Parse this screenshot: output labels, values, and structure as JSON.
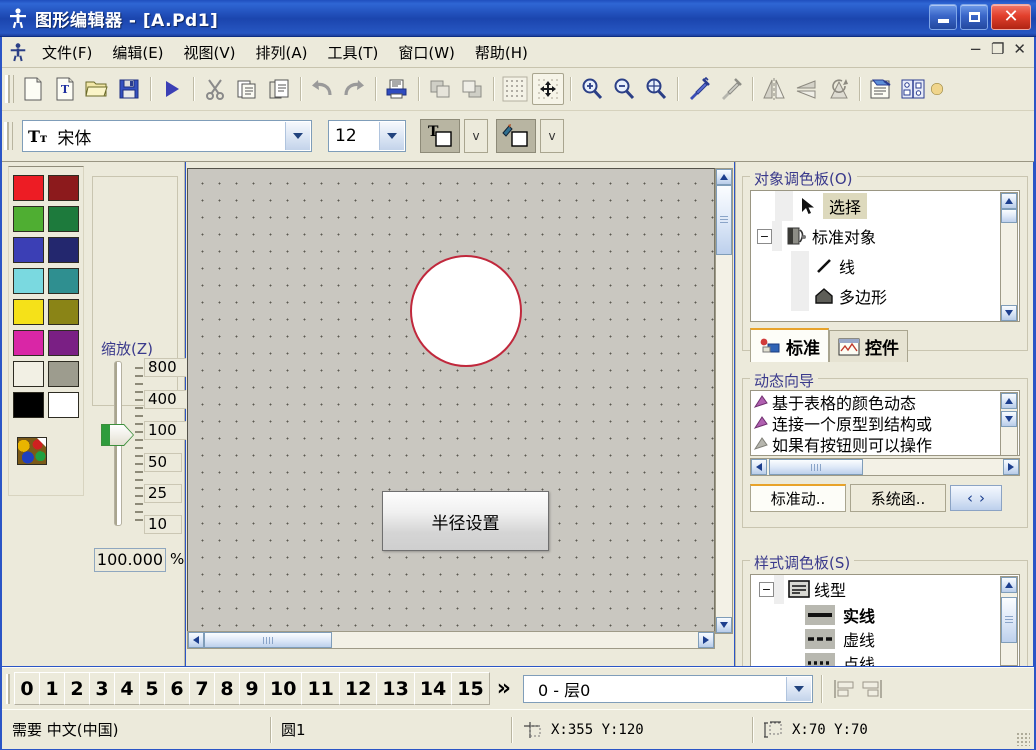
{
  "window": {
    "title": "图形编辑器 - [A.Pd1]",
    "app_icon": "person-figure-icon",
    "minimize": "minimize-icon",
    "maximize": "maximize-icon",
    "close": "close-icon"
  },
  "menu": {
    "icon": "person-figure-icon",
    "items": [
      {
        "label": "文件(F)",
        "key": "F"
      },
      {
        "label": "编辑(E)",
        "key": "E"
      },
      {
        "label": "视图(V)",
        "key": "V"
      },
      {
        "label": "排列(A)",
        "key": "A"
      },
      {
        "label": "工具(T)",
        "key": "T"
      },
      {
        "label": "窗口(W)",
        "key": "W"
      },
      {
        "label": "帮助(H)",
        "key": "H"
      }
    ],
    "mdi": {
      "minimize": "−",
      "restore": "❐",
      "close": "✕"
    }
  },
  "toolbar": {
    "buttons": [
      {
        "name": "new-icon"
      },
      {
        "name": "new-text-document-icon"
      },
      {
        "name": "open-folder-icon"
      },
      {
        "name": "save-icon"
      },
      {
        "name": "run-icon"
      },
      {
        "name": "cut-icon"
      },
      {
        "name": "copy-icon"
      },
      {
        "name": "paste-icon"
      },
      {
        "name": "undo-icon"
      },
      {
        "name": "redo-icon"
      },
      {
        "name": "print-icon"
      },
      {
        "name": "bring-to-front-icon"
      },
      {
        "name": "send-to-back-icon"
      },
      {
        "name": "grid-icon"
      },
      {
        "name": "snap-to-grid-icon"
      },
      {
        "name": "zoom-in-icon"
      },
      {
        "name": "zoom-out-icon"
      },
      {
        "name": "zoom-area-icon"
      },
      {
        "name": "eyedropper-apply-icon"
      },
      {
        "name": "eyedropper-pick-icon"
      },
      {
        "name": "flip-horizontal-icon"
      },
      {
        "name": "flip-vertical-icon"
      },
      {
        "name": "rotate-icon"
      },
      {
        "name": "properties-icon"
      },
      {
        "name": "library-icon"
      }
    ]
  },
  "fontbar": {
    "font_icon": "font-tt-icon",
    "font_name": "宋体",
    "font_size": "12",
    "text_color_button": "text-color-icon",
    "fill_color_button": "fill-color-icon",
    "dropdown_caret": "v"
  },
  "left_panel": {
    "color_palette": {
      "swatches": [
        "#ed1c24",
        "#8c1a1c",
        "#4fae32",
        "#1d7a3c",
        "#3b3fb5",
        "#23276e",
        "#7ad9e0",
        "#2f8f90",
        "#f5e119",
        "#8a8416",
        "#d926a6",
        "#7a1f84",
        "#f2f0e4",
        "#9d9c8e",
        "#000000",
        "#ffffff"
      ],
      "custom_color_label": "custom-color-icon"
    },
    "zoom": {
      "legend": "缩放(Z)",
      "legend_key": "Z",
      "ticks": [
        "800",
        "400",
        "100",
        "50",
        "25",
        "10"
      ],
      "value": "100.000",
      "unit": "%",
      "slider_position": "100"
    }
  },
  "canvas": {
    "shapes": [
      {
        "type": "circle",
        "name": "圆1",
        "stroke": "#c0283c",
        "fill": "#ffffff"
      },
      {
        "type": "button",
        "label": "半径设置"
      }
    ],
    "scrollbars": {
      "vertical": "vertical-scrollbar",
      "horizontal": "horizontal-scrollbar"
    }
  },
  "right_panel": {
    "object_palette": {
      "legend": "对象调色板(O)",
      "legend_key": "O",
      "tree": [
        {
          "label": "选择",
          "icon": "cursor-arrow-icon",
          "selected": true,
          "level": 1
        },
        {
          "label": "标准对象",
          "icon": "standard-objects-icon",
          "expander": "−",
          "level": 0
        },
        {
          "label": "线",
          "icon": "line-icon",
          "level": 2
        },
        {
          "label": "多边形",
          "icon": "polygon-icon",
          "level": 2
        }
      ],
      "tabs": [
        {
          "label": "标准",
          "icon": "shapes-icon",
          "active": true
        },
        {
          "label": "控件",
          "icon": "controls-icon",
          "active": false
        }
      ]
    },
    "dynamic_wizard": {
      "legend": "动态向导",
      "items": [
        "基于表格的颜色动态",
        "连接一个原型到结构或",
        "如果有按钮则可以操作"
      ],
      "tabs": [
        {
          "label": "标准动..",
          "active": true
        },
        {
          "label": "系统函..",
          "active": false
        }
      ],
      "nav_prev": "‹",
      "nav_next": "›"
    },
    "style_palette": {
      "legend": "样式调色板(S)",
      "legend_key": "S",
      "tree": [
        {
          "label": "线型",
          "icon": "line-style-icon",
          "expander": "−",
          "level": 0
        },
        {
          "label": "实线",
          "icon": "solid-line-icon",
          "level": 1,
          "bold": true
        },
        {
          "label": "虚线",
          "icon": "dashed-line-icon",
          "level": 1
        },
        {
          "label": "点线",
          "icon": "dotted-line-icon",
          "level": 1
        }
      ]
    }
  },
  "layer_bar": {
    "tabs": [
      "0",
      "1",
      "2",
      "3",
      "4",
      "5",
      "6",
      "7",
      "8",
      "9",
      "10",
      "11",
      "12",
      "13",
      "14",
      "15"
    ],
    "more": "»",
    "layer_select": "0 - 层0",
    "align_icons": [
      "align-left-icon",
      "align-right-icon"
    ]
  },
  "status_bar": {
    "input_mode": "需要 中文(中国)",
    "selected_object": "圆1",
    "cursor_icon": "crosshair-icon",
    "cursor_position": "X:355  Y:120",
    "size_icon": "size-icon",
    "object_position": "X:70  Y:70"
  },
  "colors": {
    "title_blue": "#1b45ae",
    "panel_bg": "#eceadb",
    "legend_blue": "#3a3a8c",
    "accent_orange": "#e8a32a",
    "circle_stroke": "#c0283c"
  }
}
